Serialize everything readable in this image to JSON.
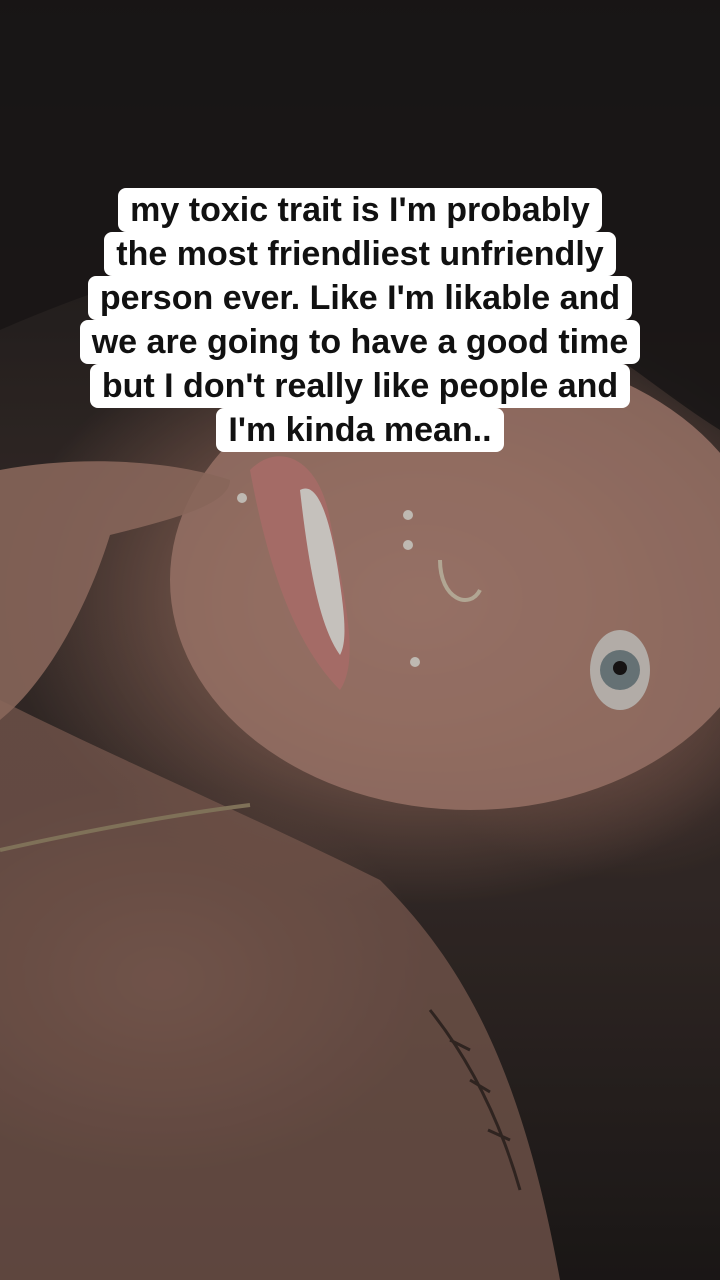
{
  "photo": {
    "description_icon": "selfie-photo"
  },
  "caption": {
    "lines": [
      "my toxic trait is I'm probably",
      "the most friendliest unfriendly",
      "person ever. Like I'm likable and",
      "we are going to have a good time",
      "but I don't really like people and",
      "I'm kinda mean.."
    ]
  },
  "colors": {
    "caption_background": "#ffffff",
    "caption_text": "#111111",
    "backdrop": "#1f1b1a"
  }
}
